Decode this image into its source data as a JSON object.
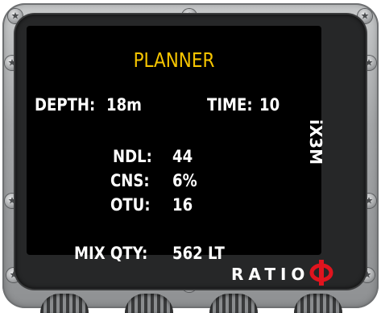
{
  "screen": {
    "title": "PLANNER",
    "depth_label": "DEPTH:",
    "depth_value": "18m",
    "time_label": "TIME:",
    "time_value": "10",
    "ndl_label": "NDL:",
    "ndl_value": "44",
    "cns_label": "CNS:",
    "cns_value": "6%",
    "otu_label": "OTU:",
    "otu_value": "16",
    "mix_label": "MIX QTY:",
    "mix_value": "562 LT"
  },
  "device": {
    "model": "iX3M",
    "brand": "RATIO",
    "brand_logo": "phi-logo-icon"
  },
  "colors": {
    "title": "#f5c400",
    "text": "#ffffff",
    "screen_bg": "#000000",
    "logo": "#e0141e"
  }
}
